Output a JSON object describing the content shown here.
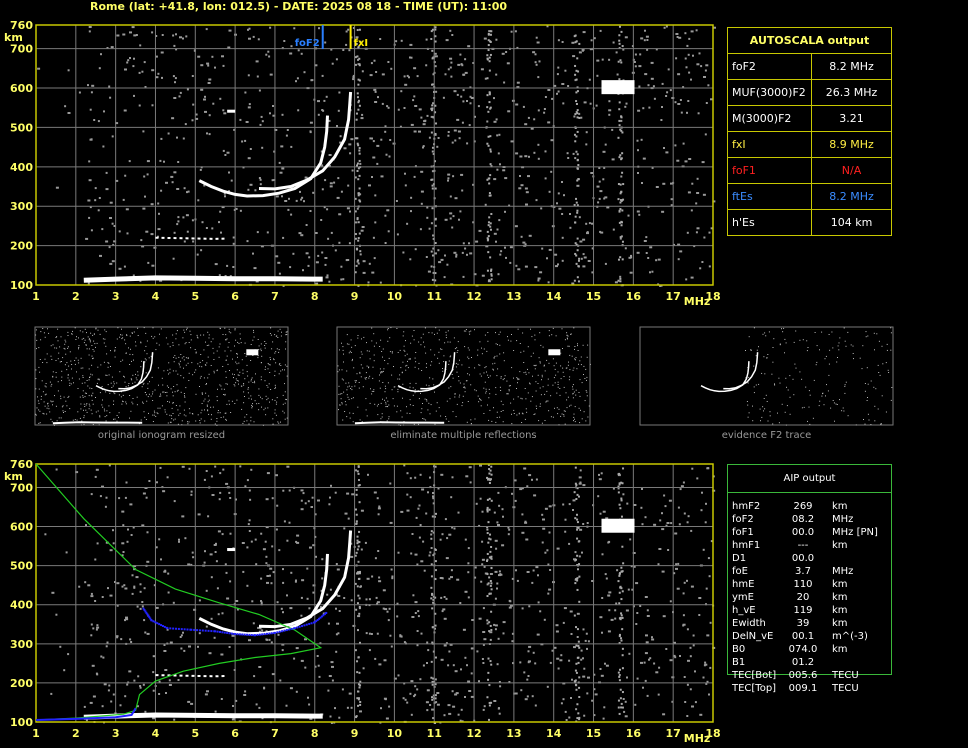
{
  "header": "Rome (lat: +41.8, lon: 012.5) - DATE: 2025 08 18 - TIME (UT): 11:00",
  "colors": {
    "grid": "#7a7a7a",
    "frame": "#c8c800",
    "trace": "#ffffff",
    "fof2_marker": "#2a7fff",
    "fxl_marker": "#ffee00",
    "profile": "#22cc22",
    "aip_trace": "#2222ff"
  },
  "axes": {
    "x_ticks": [
      "1",
      "2",
      "3",
      "4",
      "5",
      "6",
      "7",
      "8",
      "9",
      "10",
      "11",
      "12",
      "13",
      "14",
      "15",
      "16",
      "17",
      "18"
    ],
    "x_unit": "MHz",
    "y_ticks": [
      "700",
      "600",
      "500",
      "400",
      "300",
      "200",
      "100"
    ],
    "y_top": "760",
    "y_unit": "km"
  },
  "chart_data": {
    "type": "scatter",
    "xlim": [
      1,
      18
    ],
    "ylim": [
      100,
      760
    ],
    "markers": [
      {
        "label": "foF2",
        "x": 8.2
      },
      {
        "label": "fxI",
        "x": 8.9
      }
    ],
    "o_trace": [
      [
        5.1,
        365
      ],
      [
        5.4,
        350
      ],
      [
        5.7,
        338
      ],
      [
        6.0,
        330
      ],
      [
        6.3,
        326
      ],
      [
        6.7,
        327
      ],
      [
        7.1,
        333
      ],
      [
        7.5,
        345
      ],
      [
        7.9,
        370
      ],
      [
        8.15,
        410
      ],
      [
        8.25,
        450
      ],
      [
        8.3,
        490
      ],
      [
        8.32,
        530
      ]
    ],
    "x_trace": [
      [
        6.6,
        345
      ],
      [
        7.0,
        344
      ],
      [
        7.4,
        350
      ],
      [
        7.8,
        366
      ],
      [
        8.2,
        390
      ],
      [
        8.5,
        425
      ],
      [
        8.75,
        470
      ],
      [
        8.85,
        520
      ],
      [
        8.88,
        560
      ],
      [
        8.9,
        590
      ]
    ],
    "es_trace": [
      [
        2.2,
        112
      ],
      [
        3,
        115
      ],
      [
        4,
        118
      ],
      [
        5,
        117
      ],
      [
        6,
        116
      ],
      [
        7,
        116
      ],
      [
        8,
        115
      ],
      [
        8.2,
        115
      ]
    ],
    "es_layer2": [
      [
        4.0,
        220
      ],
      [
        4.5,
        219
      ],
      [
        5.0,
        218
      ],
      [
        5.5,
        217
      ],
      [
        5.8,
        218
      ]
    ],
    "profile": [
      [
        1.0,
        760
      ],
      [
        1.6,
        690
      ],
      [
        2.2,
        620
      ],
      [
        2.8,
        560
      ],
      [
        3.5,
        490
      ],
      [
        4.5,
        440
      ],
      [
        5.6,
        405
      ],
      [
        6.6,
        375
      ],
      [
        7.5,
        335
      ],
      [
        8.15,
        290
      ],
      [
        7.4,
        275
      ],
      [
        6.5,
        265
      ],
      [
        5.6,
        250
      ],
      [
        4.7,
        230
      ],
      [
        4.0,
        205
      ],
      [
        3.6,
        170
      ],
      [
        3.5,
        130
      ],
      [
        3.2,
        120
      ],
      [
        2.0,
        110
      ],
      [
        1.0,
        105
      ]
    ],
    "aip_trace": [
      [
        3.7,
        390
      ],
      [
        3.9,
        360
      ],
      [
        4.3,
        340
      ],
      [
        4.9,
        336
      ],
      [
        5.5,
        332
      ],
      [
        6.0,
        325
      ],
      [
        6.5,
        322
      ],
      [
        7.0,
        328
      ],
      [
        7.5,
        340
      ],
      [
        8.0,
        355
      ],
      [
        8.3,
        380
      ]
    ],
    "aip_low": [
      [
        1.0,
        105
      ],
      [
        2.0,
        108
      ],
      [
        3.0,
        112
      ],
      [
        3.4,
        118
      ],
      [
        3.5,
        135
      ]
    ]
  },
  "autoscala": {
    "title": "AUTOSCALA output",
    "rows": [
      {
        "name": "foF2",
        "value": "8.2 MHz",
        "color": "#ffffff"
      },
      {
        "name": "MUF(3000)F2",
        "value": "26.3 MHz",
        "color": "#ffffff"
      },
      {
        "name": "M(3000)F2",
        "value": "3.21",
        "color": "#ffffff"
      },
      {
        "name": "fxI",
        "value": "8.9 MHz",
        "color": "#ffee44"
      },
      {
        "name": "foF1",
        "value": "N/A",
        "color": "#ff2020"
      },
      {
        "name": "ftEs",
        "value": "8.2 MHz",
        "color": "#3a8cff"
      },
      {
        "name": "h'Es",
        "value": "104    km",
        "color": "#ffffff"
      }
    ]
  },
  "aip": {
    "title": "AIP output",
    "rows": [
      {
        "name": "hmF2",
        "value": "269",
        "unit": "km"
      },
      {
        "name": "foF2",
        "value": "08.2",
        "unit": "MHz"
      },
      {
        "name": "foF1",
        "value": "00.0",
        "unit": "MHz   [PN]"
      },
      {
        "name": "hmF1",
        "value": "---",
        "unit": "km"
      },
      {
        "name": "D1",
        "value": "00.0",
        "unit": ""
      },
      {
        "name": "foE",
        "value": "3.7",
        "unit": "MHz"
      },
      {
        "name": "hmE",
        "value": "110",
        "unit": "km"
      },
      {
        "name": "ymE",
        "value": "20",
        "unit": "km"
      },
      {
        "name": "h_vE",
        "value": "119",
        "unit": "km"
      },
      {
        "name": "Ewidth",
        "value": "39",
        "unit": "km"
      },
      {
        "name": "DelN_vE",
        "value": "00.1",
        "unit": "m^(-3)"
      },
      {
        "name": "B0",
        "value": "074.0",
        "unit": "km"
      },
      {
        "name": "B1",
        "value": "01.2",
        "unit": ""
      },
      {
        "name": "TEC[Bot]",
        "value": "005.6",
        "unit": "TECU"
      },
      {
        "name": "TEC[Top]",
        "value": "009.1",
        "unit": "TECU"
      }
    ]
  },
  "thumbnails": [
    {
      "caption": "original ionogram resized"
    },
    {
      "caption": "eliminate multiple reflections"
    },
    {
      "caption": "evidence F2 trace"
    }
  ]
}
